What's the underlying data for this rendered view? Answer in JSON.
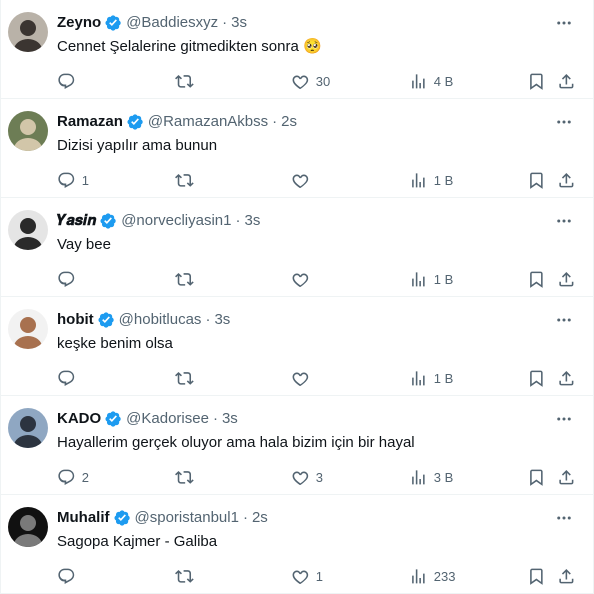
{
  "tweets": [
    {
      "name": "Zeyno",
      "handle": "@Baddiesxyz",
      "time": "3s",
      "text": "Cennet Şelalerine gitmedikten sonra 🥺",
      "replies": "",
      "retweets": "",
      "likes": "30",
      "views": "4 B",
      "avatar_colors": [
        "#b9b2a8",
        "#3b3531"
      ],
      "avatar_icon": "person-photo-icon"
    },
    {
      "name": "Ramazan",
      "handle": "@RamazanAkbss",
      "time": "2s",
      "text": "Dizisi yapılır ama bunun",
      "replies": "1",
      "retweets": "",
      "likes": "",
      "views": "1 B",
      "avatar_colors": [
        "#6d7d55",
        "#d2c6a9"
      ],
      "avatar_icon": "person-photo-icon"
    },
    {
      "name": "𝒀𝒂𝒔𝒊𝒏",
      "handle": "@norvecliyasin1",
      "time": "3s",
      "text": "Vay bee",
      "replies": "",
      "retweets": "",
      "likes": "",
      "views": "1 B",
      "avatar_colors": [
        "#e5e5e5",
        "#2a2a2a"
      ],
      "avatar_icon": "person-photo-icon"
    },
    {
      "name": "hobit",
      "handle": "@hobitlucas",
      "time": "3s",
      "text": "keşke benim olsa",
      "replies": "",
      "retweets": "",
      "likes": "",
      "views": "1 B",
      "avatar_colors": [
        "#f2f2f2",
        "#a8714f"
      ],
      "avatar_icon": "person-photo-icon"
    },
    {
      "name": "KADO",
      "handle": "@Kadorisee",
      "time": "3s",
      "text": "Hayallerim gerçek oluyor ama hala bizim için bir hayal",
      "replies": "2",
      "retweets": "",
      "likes": "3",
      "views": "3 B",
      "avatar_colors": [
        "#8fa7c2",
        "#2c3440"
      ],
      "avatar_icon": "person-photo-icon"
    },
    {
      "name": "Muhalif",
      "handle": "@sporistanbul1",
      "time": "2s",
      "text": "Sagopa Kajmer - Galiba",
      "replies": "",
      "retweets": "",
      "likes": "1",
      "views": "233",
      "avatar_colors": [
        "#111111",
        "#7a7a7a"
      ],
      "avatar_icon": "person-photo-icon"
    }
  ],
  "colors": {
    "verified": "#1d9bf0",
    "muted": "#536471",
    "text": "#0f1419",
    "divider": "#eff3f4"
  },
  "icons": {
    "verified": "verified-badge-icon",
    "more": "more-dots-icon",
    "reply": "reply-icon",
    "retweet": "retweet-icon",
    "like": "heart-icon",
    "views": "views-chart-icon",
    "bookmark": "bookmark-icon",
    "share": "share-icon"
  }
}
